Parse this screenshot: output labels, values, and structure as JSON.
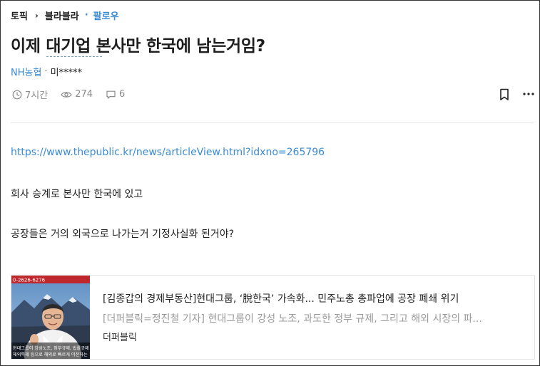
{
  "breadcrumb": {
    "topic": "토픽",
    "separator": "›",
    "board": "블라블라",
    "dot": "·",
    "follow": "팔로우"
  },
  "post": {
    "title": "이제 대기업 본사만 한국에 남는거임?",
    "company": "NH농협",
    "author_separator": "·",
    "author": "미*****",
    "time": "7시간",
    "views": "274",
    "comments": "6",
    "link": "https://www.thepublic.kr/news/articleView.html?idxno=265796",
    "paragraphs": [
      "회사 승계로 본사만 한국에 있고",
      "공장들은 거의 외국으로 나가는거 기정사실화 된거야?"
    ]
  },
  "link_card": {
    "title": "[김종갑의 경제부동산]현대그룹, ‘脫한국’ 가속화... 민주노총 총파업에 공장 폐쇄 위기",
    "description": "[더퍼블릭=정진철 기자] 현대그룹이 강성 노조, 과도한 정부 규제, 그리고 해외 시장의 파...",
    "source": "더퍼블릭",
    "thumbnail": {
      "banner_text": "0-2626-6276",
      "caption_lines": [
        "현대그룹이 강성노조, 정부규제, 법률규제",
        "해외특혜 등으로 해외로 빠르게 이전하는"
      ]
    }
  },
  "colors": {
    "accent": "#3a8bd6",
    "meta": "#8a8a8a",
    "text": "#222222"
  },
  "icons": {
    "time": "clock-icon",
    "views": "eye-icon",
    "comments": "comment-icon",
    "bookmark": "bookmark-icon",
    "more": "more-icon"
  }
}
